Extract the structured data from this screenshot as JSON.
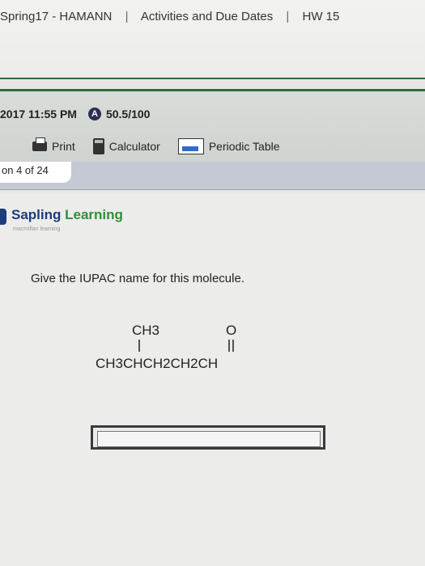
{
  "breadcrumb": {
    "course": "Spring17 - HAMANN",
    "section": "Activities and Due Dates",
    "assignment": "HW 15"
  },
  "status": {
    "due": "2017 11:55 PM",
    "grade_icon": "A",
    "score": "50.5/100"
  },
  "tools": {
    "print": "Print",
    "calculator": "Calculator",
    "periodic_table": "Periodic Table"
  },
  "question": {
    "tab": "on 4 of 24",
    "prompt": "Give the IUPAC name for this molecule.",
    "answer_value": ""
  },
  "logo": {
    "name_part1": "Sapling",
    "name_part2": "Learning",
    "subtitle": "macmillan learning"
  },
  "molecule": {
    "branch": "CH3",
    "carbonyl_o": "O",
    "chain": "CH3CHCH2CH2CH"
  }
}
